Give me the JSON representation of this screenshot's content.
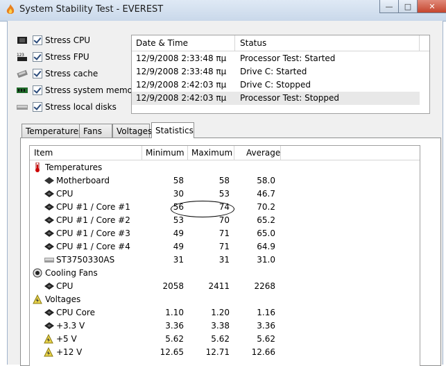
{
  "window": {
    "title": "System Stability Test - EVEREST",
    "min": "—",
    "max": "□",
    "close": "✕"
  },
  "stress": [
    {
      "label": "Stress CPU",
      "icon": "cpu-icon"
    },
    {
      "label": "Stress FPU",
      "icon": "fpu-icon"
    },
    {
      "label": "Stress cache",
      "icon": "cache-icon"
    },
    {
      "label": "Stress system memory",
      "icon": "memory-icon"
    },
    {
      "label": "Stress local disks",
      "icon": "disk-icon"
    }
  ],
  "log": {
    "headers": {
      "datetime": "Date & Time",
      "status": "Status"
    },
    "rows": [
      {
        "datetime": "12/9/2008 2:33:48 πμ",
        "status": "Processor Test: Started"
      },
      {
        "datetime": "12/9/2008 2:33:48 πμ",
        "status": "Drive C: Started"
      },
      {
        "datetime": "12/9/2008 2:42:03 πμ",
        "status": "Drive C: Stopped"
      },
      {
        "datetime": "12/9/2008 2:42:03 πμ",
        "status": "Processor Test: Stopped"
      }
    ]
  },
  "tabs": [
    "Temperatures",
    "Fans",
    "Voltages",
    "Statistics"
  ],
  "stats": {
    "headers": {
      "item": "Item",
      "min": "Minimum",
      "max": "Maximum",
      "avg": "Average"
    },
    "rows": [
      {
        "kind": "section",
        "item": "Temperatures",
        "icon": "thermometer-icon"
      },
      {
        "kind": "row",
        "item": "Motherboard",
        "min": "58",
        "max": "58",
        "avg": "58.0",
        "icon": "motherboard-icon"
      },
      {
        "kind": "row",
        "item": "CPU",
        "min": "30",
        "max": "53",
        "avg": "46.7",
        "icon": "cpu-icon"
      },
      {
        "kind": "row",
        "item": "CPU #1 / Core #1",
        "min": "56",
        "max": "74",
        "avg": "70.2",
        "icon": "cpu-icon"
      },
      {
        "kind": "row",
        "item": "CPU #1 / Core #2",
        "min": "53",
        "max": "70",
        "avg": "65.2",
        "icon": "cpu-icon"
      },
      {
        "kind": "row",
        "item": "CPU #1 / Core #3",
        "min": "49",
        "max": "71",
        "avg": "65.0",
        "icon": "cpu-icon"
      },
      {
        "kind": "row",
        "item": "CPU #1 / Core #4",
        "min": "49",
        "max": "71",
        "avg": "64.9",
        "icon": "cpu-icon"
      },
      {
        "kind": "row",
        "item": "ST3750330AS",
        "min": "31",
        "max": "31",
        "avg": "31.0",
        "icon": "disk-icon"
      },
      {
        "kind": "section",
        "item": "Cooling Fans",
        "icon": "fan-icon"
      },
      {
        "kind": "row",
        "item": "CPU",
        "min": "2058",
        "max": "2411",
        "avg": "2268",
        "icon": "cpu-icon"
      },
      {
        "kind": "section",
        "item": "Voltages",
        "icon": "voltage-icon"
      },
      {
        "kind": "row",
        "item": "CPU Core",
        "min": "1.10",
        "max": "1.20",
        "avg": "1.16",
        "icon": "cpu-icon"
      },
      {
        "kind": "row",
        "item": "+3.3 V",
        "min": "3.36",
        "max": "3.38",
        "avg": "3.36",
        "icon": "cpu-icon"
      },
      {
        "kind": "row",
        "item": "+5 V",
        "min": "5.62",
        "max": "5.62",
        "avg": "5.62",
        "icon": "voltage-icon"
      },
      {
        "kind": "row",
        "item": "+12 V",
        "min": "12.65",
        "max": "12.71",
        "avg": "12.66",
        "icon": "voltage-icon"
      }
    ]
  }
}
